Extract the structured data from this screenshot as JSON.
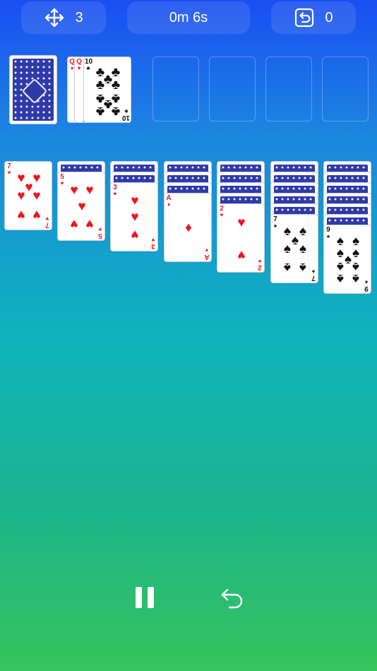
{
  "hud": {
    "moves_icon": "move-arrows-icon",
    "moves_value": "3",
    "timer_value": "0m 6s",
    "undo_icon": "undo-square-icon",
    "undo_value": "0"
  },
  "stock": {
    "icon": "card-back"
  },
  "waste": {
    "cards": [
      {
        "rank": "Q",
        "suit": "♦",
        "color": "red"
      },
      {
        "rank": "Q",
        "suit": "♥",
        "color": "red"
      },
      {
        "rank": "10",
        "suit": "♣",
        "color": "black"
      }
    ]
  },
  "foundations": [
    "",
    "",
    "",
    ""
  ],
  "tableau": [
    {
      "face_down": 0,
      "card": {
        "rank": "7",
        "suit": "♥",
        "color": "red"
      }
    },
    {
      "face_down": 1,
      "card": {
        "rank": "5",
        "suit": "♥",
        "color": "red"
      }
    },
    {
      "face_down": 2,
      "card": {
        "rank": "3",
        "suit": "♥",
        "color": "red"
      }
    },
    {
      "face_down": 3,
      "card": {
        "rank": "A",
        "suit": "♦",
        "color": "red"
      }
    },
    {
      "face_down": 4,
      "card": {
        "rank": "2",
        "suit": "♥",
        "color": "red"
      }
    },
    {
      "face_down": 5,
      "card": {
        "rank": "7",
        "suit": "♠",
        "color": "black"
      }
    },
    {
      "face_down": 6,
      "card": {
        "rank": "9",
        "suit": "♠",
        "color": "black"
      }
    }
  ],
  "controls": {
    "pause_icon": "pause-icon",
    "undo_icon": "undo-arrow-icon"
  },
  "colors": {
    "red_suit": "#f0141e",
    "black_suit": "#111111",
    "card_back": "#2f3aa8"
  }
}
